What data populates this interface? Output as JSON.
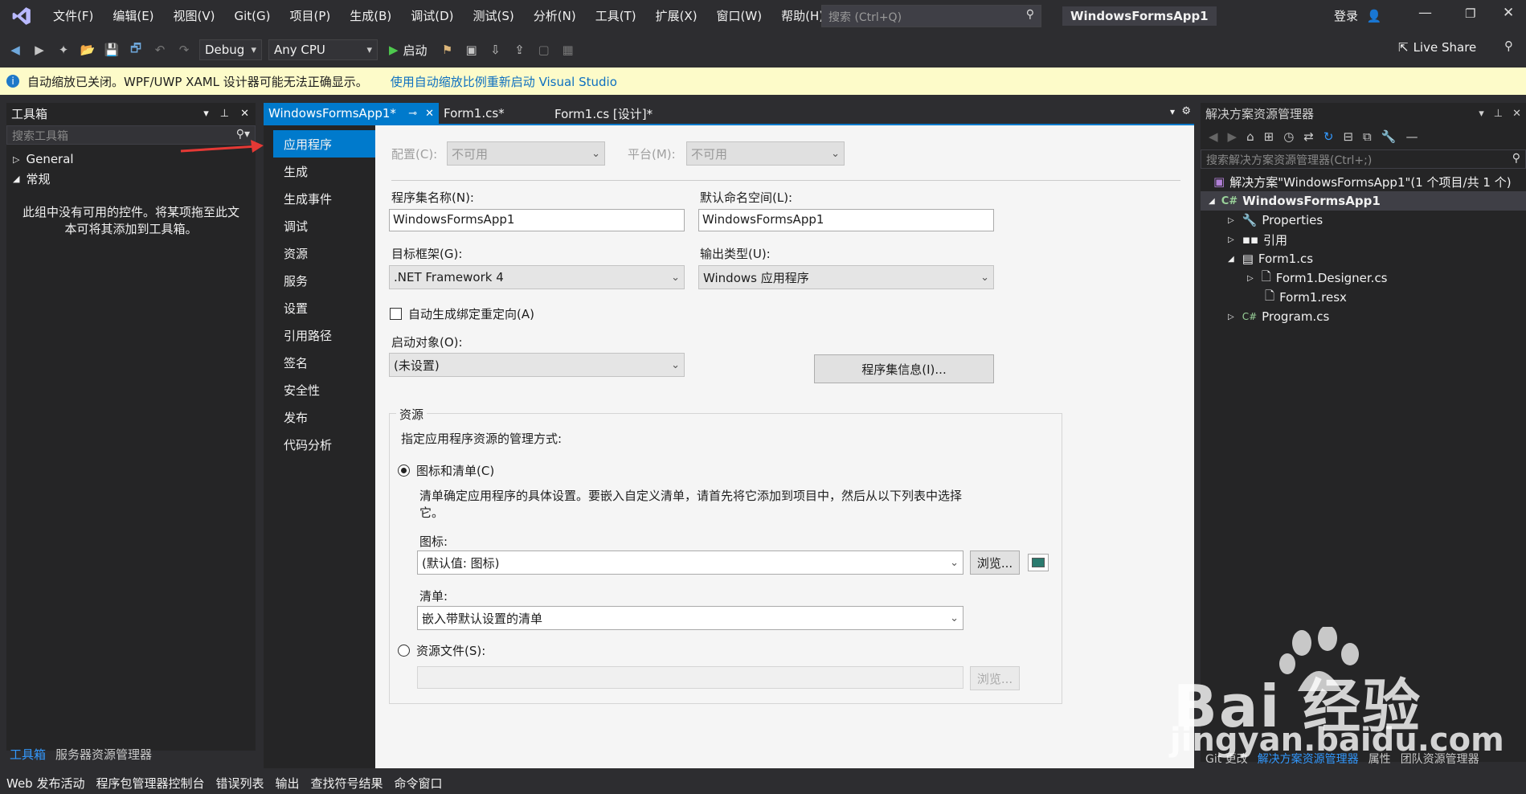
{
  "menubar": {
    "items": [
      "文件(F)",
      "编辑(E)",
      "视图(V)",
      "Git(G)",
      "项目(P)",
      "生成(B)",
      "调试(D)",
      "测试(S)",
      "分析(N)",
      "工具(T)",
      "扩展(X)",
      "窗口(W)",
      "帮助(H)"
    ],
    "search_placeholder": "搜索 (Ctrl+Q)",
    "app_title": "WindowsFormsApp1",
    "login": "登录"
  },
  "toolbar": {
    "config": "Debug",
    "platform": "Any CPU",
    "start": "启动",
    "live_share": "Live Share"
  },
  "infobar": {
    "message": "自动缩放已关闭。WPF/UWP XAML 设计器可能无法正确显示。",
    "link": "使用自动缩放比例重新启动 Visual Studio"
  },
  "toolbox": {
    "title": "工具箱",
    "search_placeholder": "搜索工具箱",
    "groups": [
      "General",
      "常规"
    ],
    "empty_message": "此组中没有可用的控件。将某项拖至此文本可将其添加到工具箱。",
    "bottom_tabs": [
      "工具箱",
      "服务器资源管理器"
    ]
  },
  "doc_tabs": {
    "active": "WindowsFormsApp1*",
    "tab2": "Form1.cs*",
    "tab3": "Form1.cs [设计]*"
  },
  "props_nav": [
    "应用程序",
    "生成",
    "生成事件",
    "调试",
    "资源",
    "服务",
    "设置",
    "引用路径",
    "签名",
    "安全性",
    "发布",
    "代码分析"
  ],
  "props": {
    "config_label": "配置(C):",
    "config_value": "不可用",
    "platform_label": "平台(M):",
    "platform_value": "不可用",
    "assembly_name_label": "程序集名称(N):",
    "assembly_name": "WindowsFormsApp1",
    "namespace_label": "默认命名空间(L):",
    "namespace": "WindowsFormsApp1",
    "framework_label": "目标框架(G):",
    "framework": ".NET Framework 4",
    "output_label": "输出类型(U):",
    "output": "Windows 应用程序",
    "auto_redirect": "自动生成绑定重定向(A)",
    "startup_label": "启动对象(O):",
    "startup": "(未设置)",
    "assembly_info_button": "程序集信息(I)...",
    "resources_group": "资源",
    "resources_desc": "指定应用程序资源的管理方式:",
    "icon_manifest_radio": "图标和清单(C)",
    "manifest_desc": "清单确定应用程序的具体设置。要嵌入自定义清单，请首先将它添加到项目中，然后从以下列表中选择它。",
    "icon_label": "图标:",
    "icon_value": "(默认值: 图标)",
    "browse": "浏览...",
    "manifest_label": "清单:",
    "manifest_value": "嵌入带默认设置的清单",
    "resource_file_radio": "资源文件(S):",
    "browse2": "浏览..."
  },
  "solution_explorer": {
    "title": "解决方案资源管理器",
    "search_placeholder": "搜索解决方案资源管理器(Ctrl+;)",
    "solution": "解决方案\"WindowsFormsApp1\"(1 个项目/共 1 个)",
    "project": "WindowsFormsApp1",
    "items": [
      "Properties",
      "引用",
      "Form1.cs",
      "Form1.Designer.cs",
      "Form1.resx",
      "Program.cs"
    ],
    "bottom_tabs": [
      "Git 更改",
      "解决方案资源管理器",
      "属性",
      "团队资源管理器"
    ]
  },
  "statusbar": [
    "Web 发布活动",
    "程序包管理器控制台",
    "错误列表",
    "输出",
    "查找符号结果",
    "命令窗口"
  ],
  "watermark": {
    "brand": "Bai 经验",
    "url": "jingyan.baidu.com"
  },
  "colors": {
    "accent": "#007acc",
    "bg": "#2d2d30",
    "annotation": "#e53935"
  }
}
